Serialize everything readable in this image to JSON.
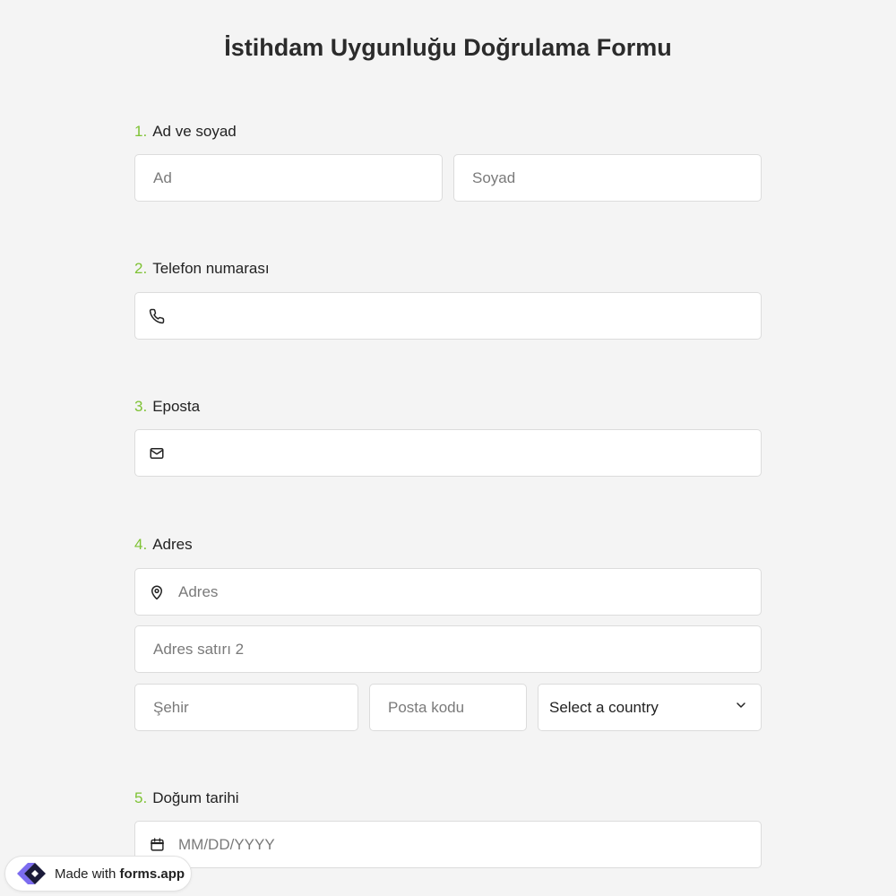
{
  "form": {
    "title": "İstihdam Uygunluğu Doğrulama Formu"
  },
  "questions": {
    "q1": {
      "number": "1.",
      "label": "Ad ve soyad",
      "first_placeholder": "Ad",
      "last_placeholder": "Soyad"
    },
    "q2": {
      "number": "2.",
      "label": "Telefon numarası",
      "icon": "phone-icon"
    },
    "q3": {
      "number": "3.",
      "label": "Eposta",
      "icon": "mail-icon"
    },
    "q4": {
      "number": "4.",
      "label": "Adres",
      "address_placeholder": "Adres",
      "address2_placeholder": "Adres satırı 2",
      "city_placeholder": "Şehir",
      "zip_placeholder": "Posta kodu",
      "country_selected": "Select a country",
      "icon": "location-pin-icon"
    },
    "q5": {
      "number": "5.",
      "label": "Doğum tarihi",
      "date_placeholder": "MM/DD/YYYY",
      "icon": "calendar-icon"
    }
  },
  "badge": {
    "prefix": "Made with",
    "brand": "forms.app"
  },
  "colors": {
    "accent_number": "#7ec234",
    "background": "#f4f4f4",
    "field_bg": "#ffffff",
    "field_border": "#dcdcdc"
  }
}
